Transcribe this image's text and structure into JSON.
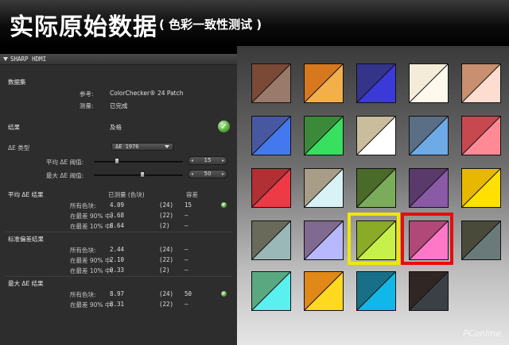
{
  "banner": {
    "title": "实际原始数据",
    "subtitle": "( 色彩一致性测试 )"
  },
  "panel": {
    "header_title": "SHARP HDMI",
    "dataset_section": "数据集",
    "reference_label": "参考:",
    "reference_value": "ColorChecker® 24 Patch",
    "measured_label": "测量:",
    "measured_value": "已完成",
    "result_label": "结果",
    "result_value": "及格",
    "delta_type_label": "ΔE 类型",
    "delta_type_value": "ΔE 1976",
    "avg_threshold_label": "平均 ΔE 阈值:",
    "avg_threshold_value": "15",
    "max_threshold_label": "最大 ΔE 阈值:",
    "max_threshold_value": "50",
    "avg_section": "平均 ΔE 结果",
    "col_measured": "已测量 (色块)",
    "col_tolerance": "容差",
    "avg_rows": [
      {
        "label": "所有色块:",
        "value": "4.09",
        "count": "(24)",
        "tol": "15",
        "ok": true
      },
      {
        "label": "在最差 90% 中:",
        "value": "3.68",
        "count": "(22)",
        "tol": "–",
        "ok": false
      },
      {
        "label": "在最差 10% 中:",
        "value": "8.64",
        "count": "(2)",
        "tol": "–",
        "ok": false
      }
    ],
    "std_section": "标准偏差结果",
    "std_rows": [
      {
        "label": "所有色块:",
        "value": "2.44",
        "count": "(24)",
        "tol": "–",
        "ok": false
      },
      {
        "label": "在最差 90% 中:",
        "value": "2.10",
        "count": "(22)",
        "tol": "–",
        "ok": false
      },
      {
        "label": "在最差 10% 中:",
        "value": "0.33",
        "count": "(2)",
        "tol": "–",
        "ok": false
      }
    ],
    "max_section": "最大 ΔE 结果",
    "max_rows": [
      {
        "label": "所有色块:",
        "value": "8.97",
        "count": "(24)",
        "tol": "50",
        "ok": true
      },
      {
        "label": "在最差 90% 中:",
        "value": "8.31",
        "count": "(22)",
        "tol": "–",
        "ok": false
      }
    ]
  },
  "swatches": [
    {
      "ref": "#7a4a36",
      "meas": "#9a7a6a"
    },
    {
      "ref": "#d8781e",
      "meas": "#f3b04a"
    },
    {
      "ref": "#34348a",
      "meas": "#3a3ad8"
    },
    {
      "ref": "#f4ecd8",
      "meas": "#fff8ec"
    },
    {
      "ref": "#c89070",
      "meas": "#ffdcd0"
    },
    {
      "ref": "#4858a0",
      "meas": "#4478ee"
    },
    {
      "ref": "#3a8a3a",
      "meas": "#38e060"
    },
    {
      "ref": "#cabd9c",
      "meas": "#ffffff"
    },
    {
      "ref": "#5a6e86",
      "meas": "#6eaae6"
    },
    {
      "ref": "#c84850",
      "meas": "#ff8a96"
    },
    {
      "ref": "#b03034",
      "meas": "#ee3a44"
    },
    {
      "ref": "#a89e88",
      "meas": "#d8f2f6"
    },
    {
      "ref": "#4a6a2a",
      "meas": "#7aac5a"
    },
    {
      "ref": "#5a3a6a",
      "meas": "#8a5aa6"
    },
    {
      "ref": "#e8b800",
      "meas": "#ffe000"
    },
    {
      "ref": "#6a6a5a",
      "meas": "#9ab8b8"
    },
    {
      "ref": "#806a90",
      "meas": "#b8b8ff"
    },
    {
      "ref": "#8aaa28",
      "meas": "#c8f04a"
    },
    {
      "ref": "#b04878",
      "meas": "#ff78c8"
    },
    {
      "ref": "#4a4a3a",
      "meas": "#6a7a7a"
    },
    {
      "ref": "#5aa880",
      "meas": "#5af0f0"
    },
    {
      "ref": "#e08818",
      "meas": "#ffd820"
    },
    {
      "ref": "#187088",
      "meas": "#10b8e8"
    },
    {
      "ref": "#302624",
      "meas": "#3a4046"
    }
  ],
  "highlight_colors": {
    "yellow": "#f2e600",
    "red": "#e80c0c"
  },
  "watermark": "PConline"
}
